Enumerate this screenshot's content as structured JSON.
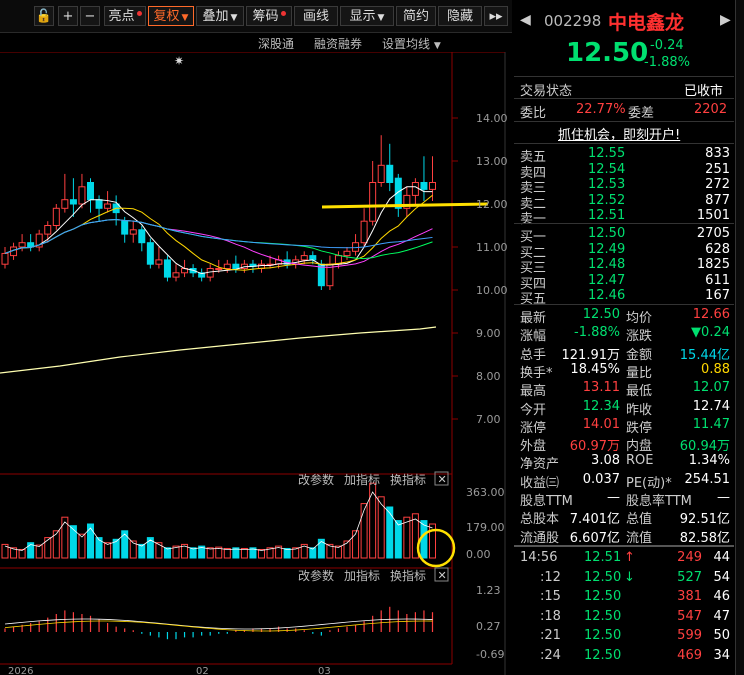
{
  "toolbar": {
    "items": [
      {
        "label": "亮点",
        "dot": true,
        "active": false,
        "caret": false
      },
      {
        "label": "复权",
        "dot": false,
        "active": true,
        "caret": true
      },
      {
        "label": "叠加",
        "dot": false,
        "active": false,
        "caret": true
      },
      {
        "label": "筹码",
        "dot": true,
        "active": false,
        "caret": false
      },
      {
        "label": "画线",
        "dot": false,
        "active": false,
        "caret": false
      },
      {
        "label": "显示",
        "dot": false,
        "active": false,
        "caret": true
      },
      {
        "label": "简约",
        "dot": false,
        "active": false,
        "caret": false
      },
      {
        "label": "隐藏",
        "dot": false,
        "active": false,
        "caret": false
      }
    ],
    "plus": "+",
    "minus": "−",
    "collapse": "▸▸"
  },
  "subbar": {
    "link1": "深股通",
    "link2": "融资融券",
    "link3": "设置均线"
  },
  "chart": {
    "y_ticks": [
      "14.00",
      "13.00",
      "12.00",
      "11.00",
      "10.00",
      "9.00",
      "8.00",
      "7.00"
    ],
    "vol_ticks": [
      "363.00",
      "179.00",
      "0.00"
    ],
    "macd_ticks": [
      "1.23",
      "0.27",
      "-0.69"
    ],
    "x_labels": [
      "2026",
      "02",
      "03"
    ],
    "vol_tools": {
      "params": "改参数",
      "add": "加指标",
      "switch": "换指标"
    },
    "macd_tools": {
      "params": "改参数",
      "add": "加指标",
      "switch": "换指标"
    }
  },
  "stock": {
    "code": "002298",
    "name": "中电鑫龙",
    "price": "12.50",
    "change": "-0.24",
    "pct": "-1.88%",
    "status_label": "交易状态",
    "status": "已收市",
    "weibi_label": "委比",
    "weibi": "22.77%",
    "weicha_label": "委差",
    "weicha": "2202",
    "banner": "抓住机会，即刻开户!"
  },
  "asks": [
    {
      "label": "卖五",
      "price": "12.55",
      "vol": "833"
    },
    {
      "label": "卖四",
      "price": "12.54",
      "vol": "251"
    },
    {
      "label": "卖三",
      "price": "12.53",
      "vol": "272"
    },
    {
      "label": "卖二",
      "price": "12.52",
      "vol": "877"
    },
    {
      "label": "卖一",
      "price": "12.51",
      "vol": "1501"
    }
  ],
  "bids": [
    {
      "label": "买一",
      "price": "12.50",
      "vol": "2705"
    },
    {
      "label": "买二",
      "price": "12.49",
      "vol": "628"
    },
    {
      "label": "买三",
      "price": "12.48",
      "vol": "1825"
    },
    {
      "label": "买四",
      "price": "12.47",
      "vol": "611"
    },
    {
      "label": "买五",
      "price": "12.46",
      "vol": "167"
    }
  ],
  "stats": [
    {
      "l1": "最新",
      "v1": "12.50",
      "c1": "green",
      "l2": "均价",
      "v2": "12.66",
      "c2": "red"
    },
    {
      "l1": "涨幅",
      "v1": "-1.88%",
      "c1": "green",
      "l2": "涨跌",
      "v2": "▼0.24",
      "c2": "green"
    },
    {
      "l1": "总手",
      "v1": "121.91万",
      "c1": "white",
      "l2": "金额",
      "v2": "15.44亿",
      "c2": "cyan"
    },
    {
      "l1": "换手*",
      "v1": "18.45%",
      "c1": "white",
      "l2": "量比",
      "v2": "0.88",
      "c2": "yellow"
    },
    {
      "l1": "最高",
      "v1": "13.11",
      "c1": "red",
      "l2": "最低",
      "v2": "12.07",
      "c2": "green"
    },
    {
      "l1": "今开",
      "v1": "12.34",
      "c1": "green",
      "l2": "昨收",
      "v2": "12.74",
      "c2": "white"
    },
    {
      "l1": "涨停",
      "v1": "14.01",
      "c1": "red",
      "l2": "跌停",
      "v2": "11.47",
      "c2": "green"
    },
    {
      "l1": "外盘",
      "v1": "60.97万",
      "c1": "red",
      "l2": "内盘",
      "v2": "60.94万",
      "c2": "green"
    },
    {
      "l1": "净资产",
      "v1": "3.08",
      "c1": "white",
      "l2": "ROE",
      "v2": "1.34%",
      "c2": "white"
    },
    {
      "l1": "收益㈢",
      "v1": "0.037",
      "c1": "white",
      "l2": "PE(动)*",
      "v2": "254.51",
      "c2": "white"
    },
    {
      "l1": "股息TTM",
      "v1": "—",
      "c1": "white",
      "l2": "股息率TTM",
      "v2": "—",
      "c2": "white"
    },
    {
      "l1": "总股本",
      "v1": "7.401亿",
      "c1": "white",
      "l2": "总值",
      "v2": "92.51亿",
      "c2": "white"
    },
    {
      "l1": "流通股",
      "v1": "6.607亿",
      "c1": "white",
      "l2": "流值",
      "v2": "82.58亿",
      "c2": "white"
    }
  ],
  "ticks": [
    {
      "time": "14:56",
      "price": "12.51",
      "arrow": "↑",
      "arrow_color": "red",
      "vol": "249",
      "vol_color": "red",
      "n": "44"
    },
    {
      "time": ":12",
      "price": "12.50",
      "arrow": "↓",
      "arrow_color": "green",
      "vol": "527",
      "vol_color": "green",
      "n": "54"
    },
    {
      "time": ":15",
      "price": "12.50",
      "arrow": "",
      "arrow_color": "",
      "vol": "381",
      "vol_color": "red",
      "n": "46"
    },
    {
      "time": ":18",
      "price": "12.50",
      "arrow": "",
      "arrow_color": "",
      "vol": "547",
      "vol_color": "red",
      "n": "47"
    },
    {
      "time": ":21",
      "price": "12.50",
      "arrow": "",
      "arrow_color": "",
      "vol": "599",
      "vol_color": "red",
      "n": "50"
    },
    {
      "time": ":24",
      "price": "12.50",
      "arrow": "",
      "arrow_color": "",
      "vol": "469",
      "vol_color": "red",
      "n": "34"
    }
  ],
  "colors": {
    "up": "#ff4040",
    "down": "#00d8e8",
    "bg": "#000000",
    "grid": "#8b0000",
    "accent": "#ff6a2a"
  }
}
